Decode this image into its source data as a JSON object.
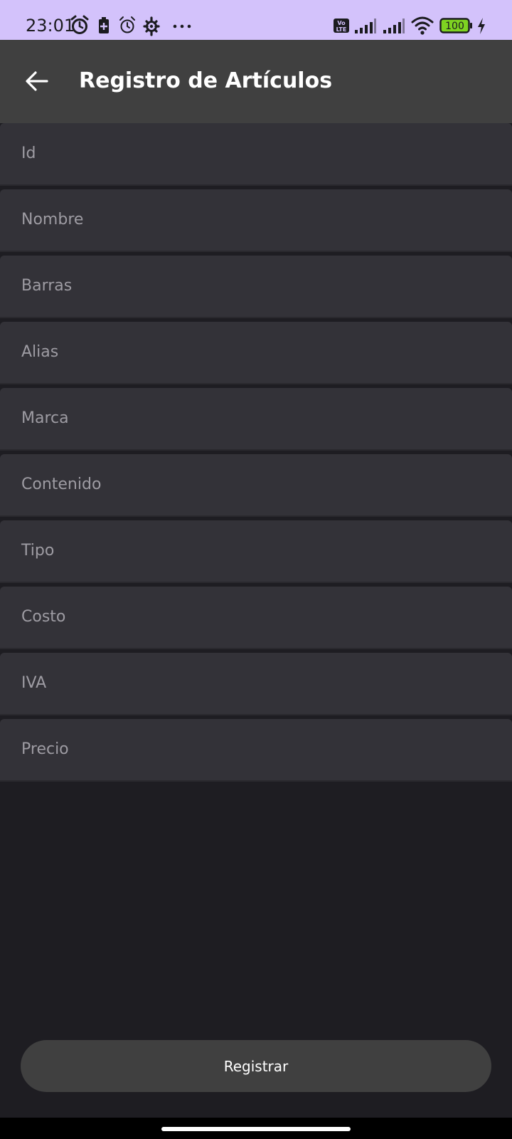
{
  "status_bar": {
    "time": "23:01",
    "battery_level": "100",
    "network_label": "Vo LTE",
    "bg_color": "#d3c2fb",
    "icons": [
      "alarm-icon",
      "battery-saver-icon",
      "alarm-outline-icon",
      "settings-gear-icon",
      "more-dots-icon",
      "volte-icon",
      "signal-icon",
      "signal-icon",
      "wifi-icon",
      "battery-icon",
      "charging-bolt-icon"
    ]
  },
  "app_bar": {
    "title": "Registro de Artículos",
    "back_icon": "arrow-back-icon",
    "bg_color": "#404040"
  },
  "form": {
    "fields": [
      {
        "placeholder": "Id",
        "value": ""
      },
      {
        "placeholder": "Nombre",
        "value": ""
      },
      {
        "placeholder": "Barras",
        "value": ""
      },
      {
        "placeholder": "Alias",
        "value": ""
      },
      {
        "placeholder": "Marca",
        "value": ""
      },
      {
        "placeholder": "Contenido",
        "value": ""
      },
      {
        "placeholder": "Tipo",
        "value": ""
      },
      {
        "placeholder": "Costo",
        "value": ""
      },
      {
        "placeholder": "IVA",
        "value": ""
      },
      {
        "placeholder": "Precio",
        "value": ""
      }
    ]
  },
  "actions": {
    "register_label": "Registrar"
  },
  "colors": {
    "background": "#1e1d22",
    "field_bg": "#333238",
    "placeholder_text": "#9e9ca3",
    "button_bg": "#404040"
  }
}
